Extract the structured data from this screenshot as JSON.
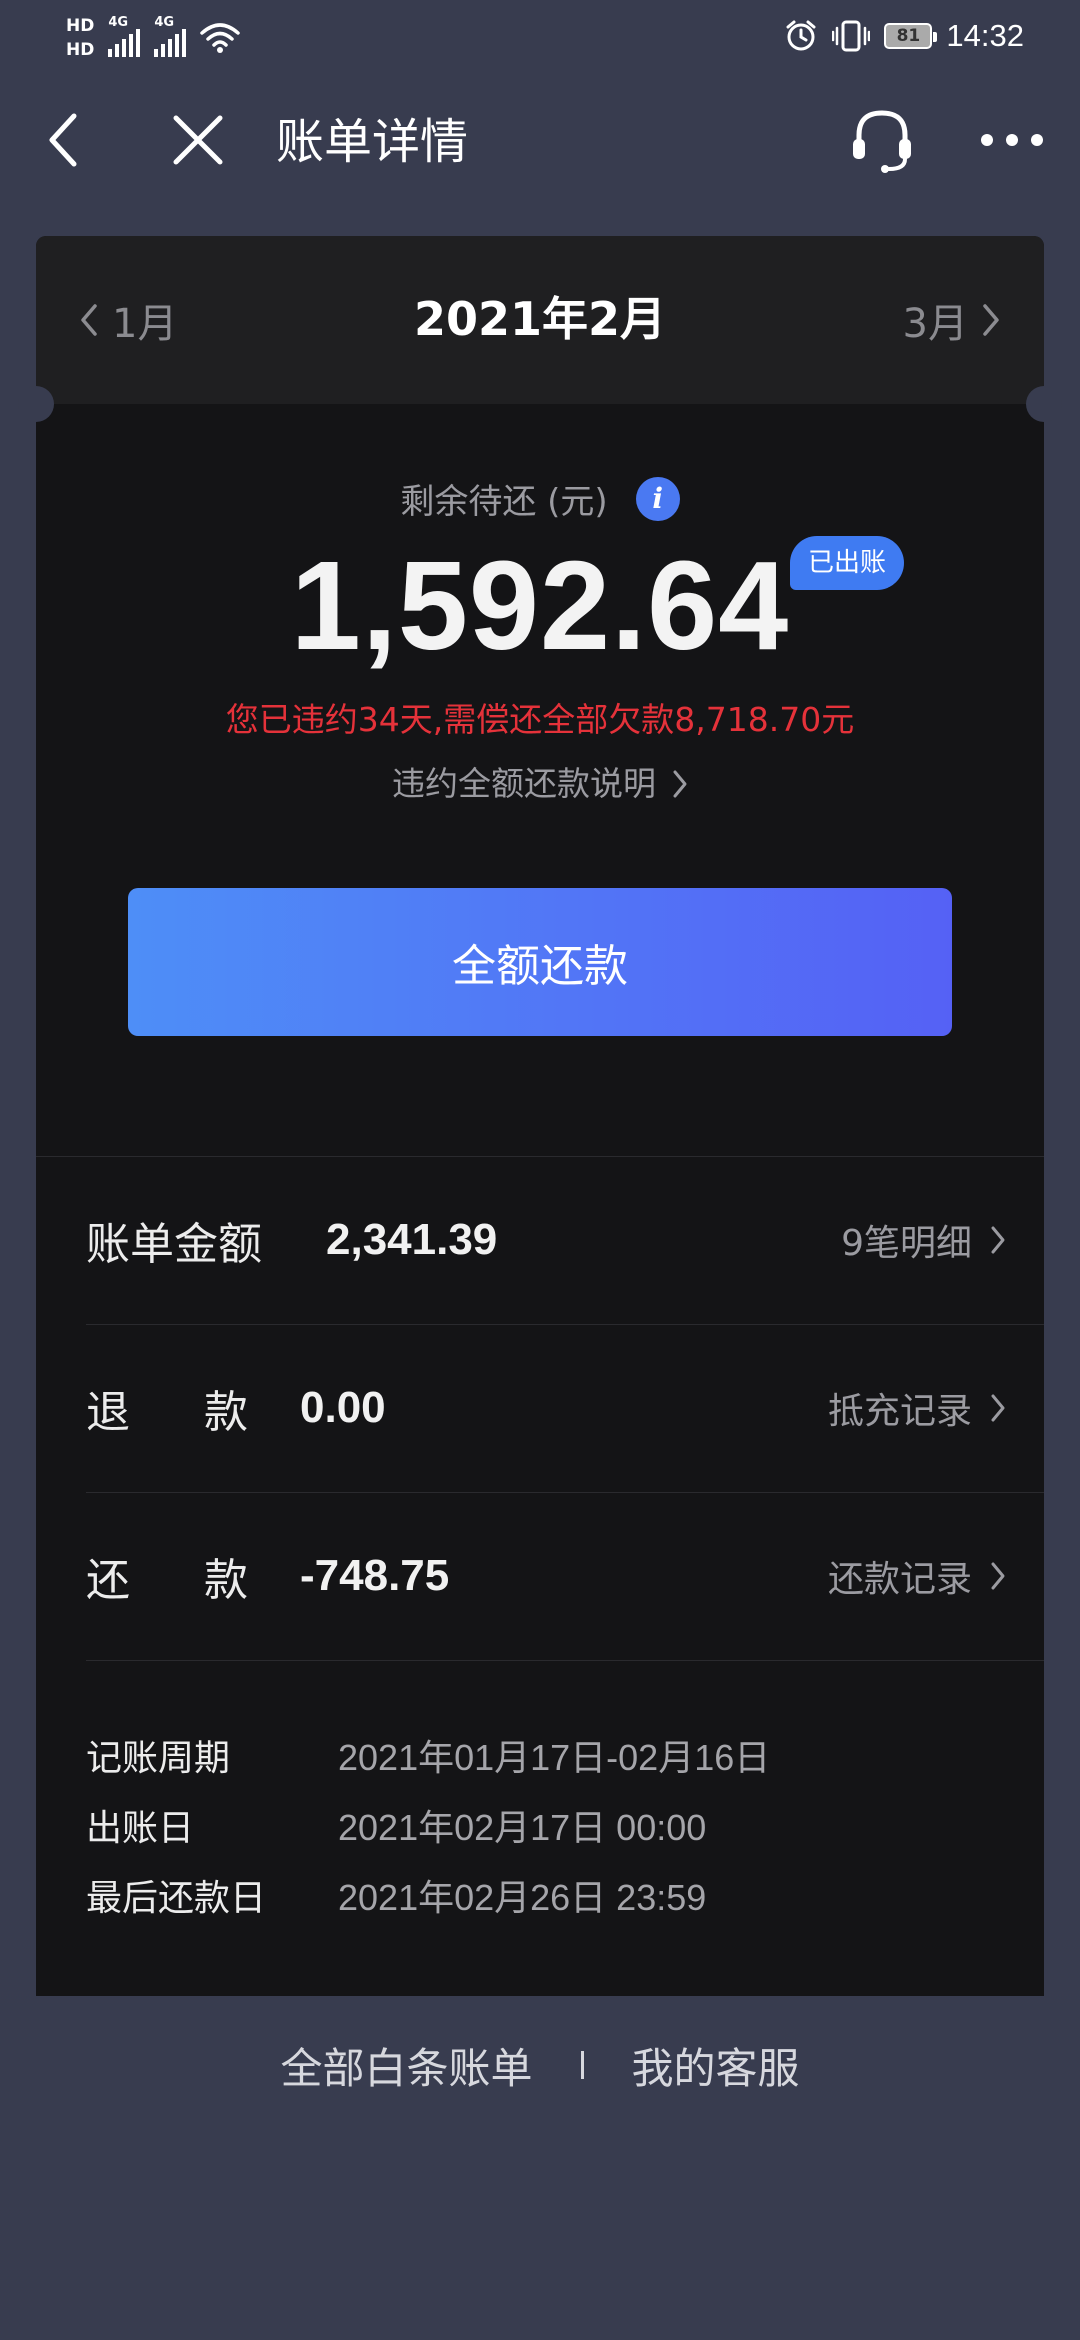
{
  "status_bar": {
    "hd1": "HD",
    "hd2": "HD",
    "net1": "4G",
    "net2": "4G",
    "battery": "81",
    "time": "14:32",
    "icons": [
      "alarm-icon",
      "vibrate-icon",
      "wifi-icon",
      "signal-icon"
    ]
  },
  "nav": {
    "title": "账单详情",
    "icons": [
      "back-icon",
      "close-icon",
      "headset-icon",
      "more-icon"
    ]
  },
  "month_switcher": {
    "prev": "1月",
    "current": "2021年2月",
    "next": "3月"
  },
  "summary": {
    "remaining_label": "剩余待还 (元)",
    "amount": "1,592.64",
    "status_badge": "已出账",
    "overdue_notice": "您已违约34天,需偿还全部欠款8,718.70元",
    "explain_link": "违约全额还款说明",
    "pay_button": "全额还款"
  },
  "rows": [
    {
      "label": "账单金额",
      "value": "2,341.39",
      "link": "9笔明细"
    },
    {
      "label_a": "退",
      "label_b": "款",
      "value": "0.00",
      "link": "抵充记录"
    },
    {
      "label_a": "还",
      "label_b": "款",
      "value": "-748.75",
      "link": "还款记录"
    }
  ],
  "details": [
    {
      "key": "记账周期",
      "value": "2021年01月17日-02月16日"
    },
    {
      "key": "出账日",
      "value": "2021年02月17日 00:00"
    },
    {
      "key": "最后还款日",
      "value": "2021年02月26日 23:59"
    }
  ],
  "footer": {
    "all_bills": "全部白条账单",
    "service": "我的客服"
  },
  "colors": {
    "page_bg": "#383c4f",
    "card_bg": "#141416",
    "accent": "#4a79f2",
    "alert": "#e5323a"
  }
}
